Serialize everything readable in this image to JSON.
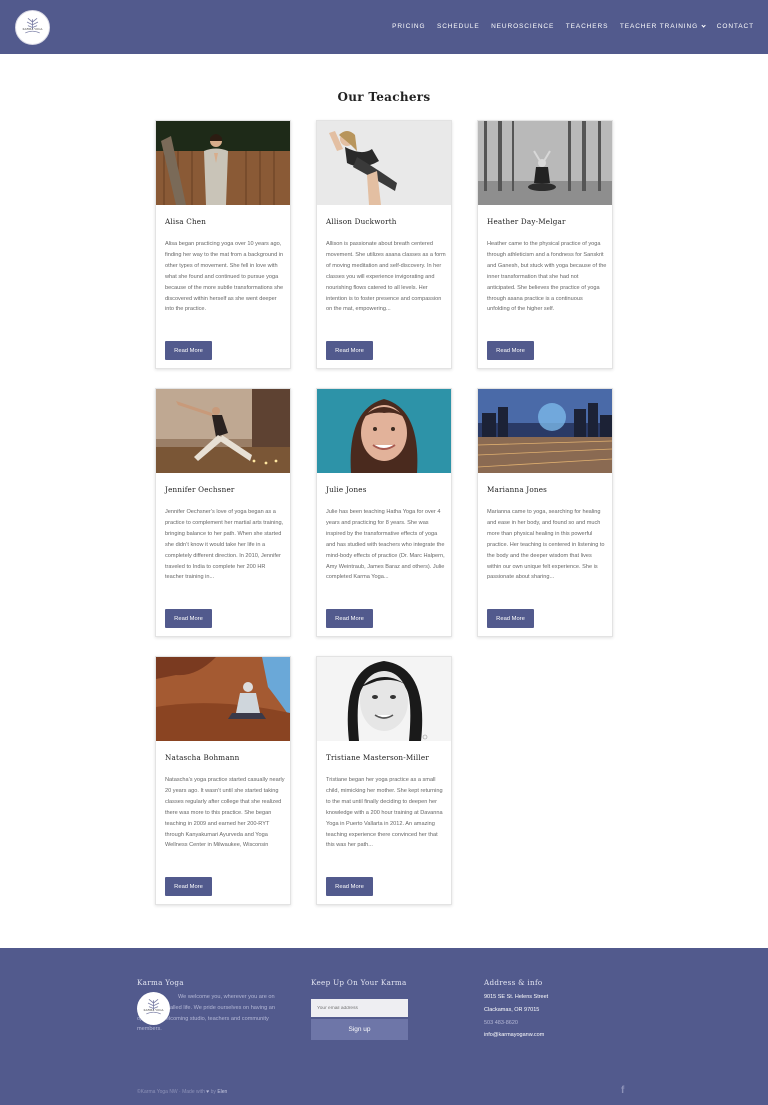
{
  "header": {
    "logo_text": "KARMA YOGA",
    "nav": [
      {
        "label": "PRICING"
      },
      {
        "label": "SCHEDULE"
      },
      {
        "label": "NEUROSCIENCE"
      },
      {
        "label": "TEACHERS"
      },
      {
        "label": "TEACHER TRAINING"
      },
      {
        "label": "CONTACT"
      }
    ]
  },
  "page_title": "Our Teachers",
  "read_more_label": "Read More",
  "teachers": [
    {
      "name": "Alisa Chen",
      "bio": "Alisa began practicing yoga over 10 years ago, finding her way to the mat from a background in other types of movement. She fell in love with what she found and continued to pursue yoga because of the more subtle transformations she discovered within herself as she went deeper into the practice."
    },
    {
      "name": "Allison Duckworth",
      "bio": "Allison is passionate about breath centered movement. She utilizes asana classes as a form of moving meditation and self-discovery. In her classes you will experience invigorating and nourishing flows catered to all levels. Her intention is to foster presence and compassion on the mat, empowering..."
    },
    {
      "name": "Heather Day-Melgar",
      "bio": "Heather came to the physical practice of yoga through athleticism and a fondness for Sanskrit and Ganesh, but stuck with yoga because of the inner transformation that she had not anticipated. She believes the practice of yoga through asana practice is a continuous unfolding of the higher self."
    },
    {
      "name": "Jennifer Oechsner",
      "bio": "Jennifer Oechsner’s love of yoga began as a practice to complement her martial arts training, bringing balance to her path. When she started she didn’t know it would take her life in a completely different direction. In 2010, Jennifer traveled to India to complete her 200 HR teacher training in..."
    },
    {
      "name": "Julie Jones",
      "bio": "Julie has been teaching Hatha Yoga for over 4 years and practicing for 8 years. She was inspired by the transformative effects of yoga and has studied with teachers who integrate the mind-body effects of practice (Dr. Marc Halpern, Amy Weintraub, James Baraz and others). Julie completed Karma Yoga..."
    },
    {
      "name": "Marianna Jones",
      "bio": "Marianna came to yoga, searching for healing and ease in her body, and found so and much more than physical healing in this powerful practice. Her teaching is centered in listening to the body and the deeper wisdom that lives within our own unique felt experience. She is passionate about sharing..."
    },
    {
      "name": "Natascha Bohmann",
      "bio": "Natascha’s yoga practice started casually nearly 20 years ago. It wasn’t until she started taking classes regularly after college that she realized there was more to this practice. She began teaching in 2009 and earned her 200-RYT through Kanyakumari Ayurveda and Yoga Wellness Center in Milwaukee, Wisconsin"
    },
    {
      "name": "Tristiane Masterson-Miller",
      "bio": "Tristiane began her yoga practice as a small child, mimicking her mother. She kept returning to the mat until finally deciding to deepen her knowledge with a 200 hour training at Davanna Yoga in Puerto Vallarta in 2012. An amazing teaching experience there convinced her that this was her path..."
    }
  ],
  "footer": {
    "col1_title": "Karma Yoga",
    "about": "We welcome you, wherever you are on this journey called life. We pride ourselves on having an open and welcoming studio, teachers and community members.",
    "col2_title": "Keep Up On Your Karma",
    "email_placeholder": "Your email address",
    "signup_label": "Sign up",
    "col3_title": "Address & info",
    "address_line1": "9015 SE St. Helens Street",
    "address_line2": "Clackamas, OR 97015",
    "phone": "503 483-8620",
    "email": "info@karmayoganw.com",
    "bottom_prefix": "©Karma Yoga NW · Made with",
    "bottom_suffix": "by",
    "bottom_brand": "Elen",
    "facebook_glyph": "f"
  },
  "colors": {
    "brand": "#525a8d",
    "button": "#525a8d",
    "signup": "#6e76a8"
  },
  "icons": [
    "logo-icon",
    "chevron-down-icon",
    "heart-icon",
    "facebook-icon"
  ]
}
